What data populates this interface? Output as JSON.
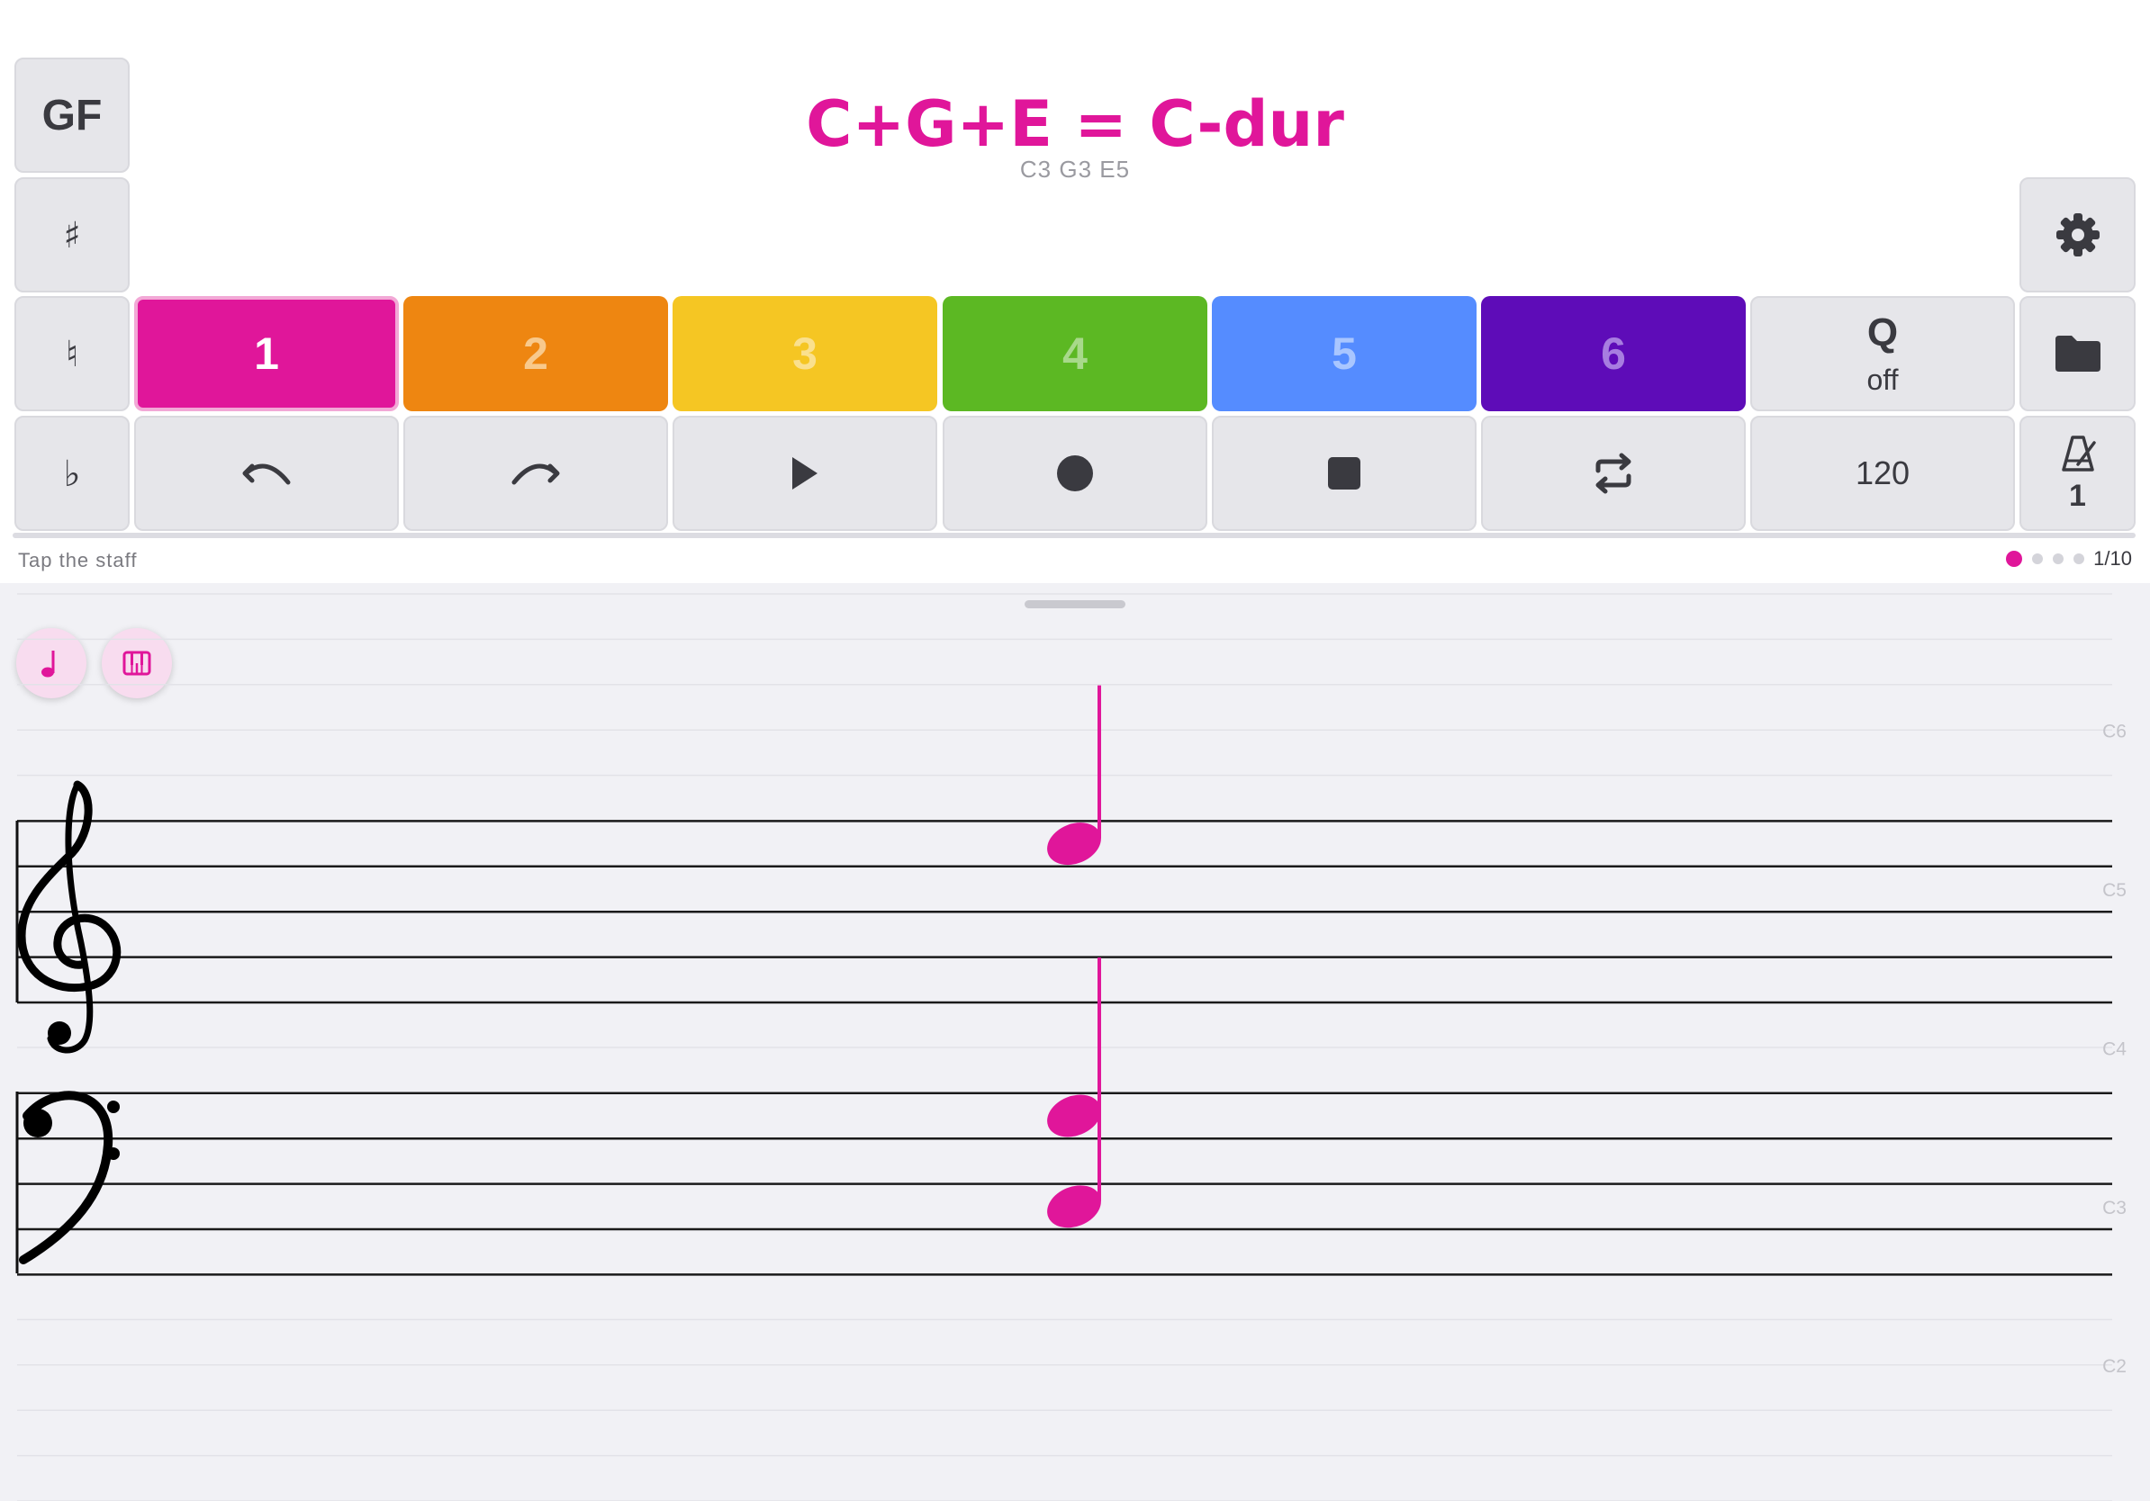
{
  "header": {
    "chord_title": "C+G+E = C-dur",
    "chord_notes": "C3 G3 E5"
  },
  "left_column": {
    "gf_label": "GF",
    "sharp_label": "♯",
    "natural_label": "♮",
    "flat_label": "♭"
  },
  "voices": [
    {
      "label": "1",
      "color": "#e0169a",
      "text_color": "#ffffff",
      "selected": true
    },
    {
      "label": "2",
      "color": "#ee8611",
      "text_color": "#f8c98c",
      "selected": false
    },
    {
      "label": "3",
      "color": "#f5c623",
      "text_color": "#fae08e",
      "selected": false
    },
    {
      "label": "4",
      "color": "#5cb823",
      "text_color": "#a8d98a",
      "selected": false
    },
    {
      "label": "5",
      "color": "#558cff",
      "text_color": "#a9c6ff",
      "selected": false
    },
    {
      "label": "6",
      "color": "#5e0cb8",
      "text_color": "#a77de0",
      "selected": false
    }
  ],
  "quantize": {
    "label": "Q",
    "value": "off"
  },
  "transport": {
    "undo_icon": "undo-icon",
    "redo_icon": "redo-icon",
    "play_icon": "play-icon",
    "record_icon": "record-icon",
    "stop_icon": "stop-icon",
    "loop_icon": "loop-icon",
    "tempo": "120"
  },
  "metronome": {
    "icon": "metronome-icon",
    "value": "1"
  },
  "right_column": {
    "settings_icon": "gear-icon",
    "files_icon": "folder-icon"
  },
  "status": {
    "hint": "Tap the staff",
    "page": "1/10",
    "page_index": 1,
    "page_dots_visible": 4
  },
  "mode_buttons": {
    "note_icon": "music-note-icon",
    "piano_icon": "piano-icon"
  },
  "staff": {
    "reference_labels": [
      "C6",
      "C5",
      "C4",
      "C3",
      "C2"
    ],
    "clefs": [
      "treble-clef",
      "bass-clef"
    ],
    "notes": [
      "E5",
      "G3",
      "C3"
    ],
    "note_color": "#e0169a"
  }
}
